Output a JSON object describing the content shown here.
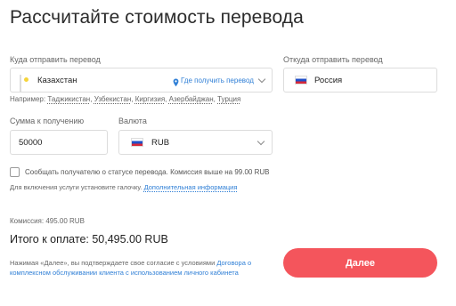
{
  "page": {
    "title": "Рассчитайте стоимость перевода"
  },
  "destination": {
    "label": "Куда отправить перевод",
    "country": "Казахстан",
    "where_receive_link": "Где получить перевод",
    "examples_prefix": "Например:",
    "examples": [
      "Таджикистан",
      "Узбекистан",
      "Киргизия",
      "Азербайджан",
      "Турция"
    ]
  },
  "origin": {
    "label": "Откуда отправить перевод",
    "country": "Россия"
  },
  "amount": {
    "label": "Сумма к получению",
    "value": "50000"
  },
  "currency": {
    "label": "Валюта",
    "value": "RUB"
  },
  "notify": {
    "text": "Сообщать получателю о статусе перевода. Комиссия выше на 99.00 RUB",
    "hint_prefix": "Для включения услуги установите галочку.",
    "hint_link": "Дополнительная информация",
    "checked": false
  },
  "summary": {
    "commission": "Комиссия: 495.00 RUB",
    "total": "Итого к оплате: 50,495.00 RUB"
  },
  "consent": {
    "text_prefix": "Нажимая «Далее», вы подтверждаете свое согласие с условиями",
    "link": "Договора о комплексном обслуживании клиента с использованием личного кабинета"
  },
  "actions": {
    "next_label": "Далее"
  },
  "icons": {
    "kz_flag": "kazakhstan-flag-icon",
    "ru_flag": "russia-flag-icon",
    "location": "location-pin-icon",
    "chevron": "chevron-down-icon"
  },
  "colors": {
    "accent_button": "#f4555c",
    "link": "#2f7fd6"
  }
}
